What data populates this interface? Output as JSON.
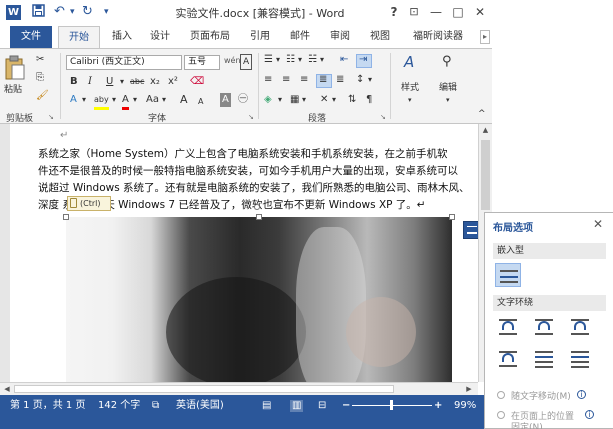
{
  "window": {
    "title": "实验文件.docx [兼容模式] - Word",
    "app_icon": "W",
    "quick_access": [
      "save-icon",
      "undo-icon",
      "redo-icon",
      "customize-icon"
    ],
    "controls": {
      "help": "?",
      "ribbon_opts": "⊡",
      "minimize": "—",
      "restore": "□",
      "close": "✕"
    }
  },
  "tabs": [
    {
      "label": "文件"
    },
    {
      "label": "开始"
    },
    {
      "label": "插入"
    },
    {
      "label": "设计"
    },
    {
      "label": "页面布局"
    },
    {
      "label": "引用"
    },
    {
      "label": "邮件"
    },
    {
      "label": "审阅"
    },
    {
      "label": "视图"
    },
    {
      "label": "福昕阅读器"
    }
  ],
  "ribbon": {
    "paste_label": "粘贴",
    "clipboard_label": "剪贴板",
    "font_name": "Calibri (西文正文)",
    "font_size": "五号",
    "font_label": "字体",
    "paragraph_label": "段落",
    "styles_label": "样式",
    "editing_label": "编辑",
    "bold": "B",
    "italic": "I",
    "underline": "U",
    "strike": "abc",
    "subscript": "x₂",
    "superscript": "x²",
    "text_effects": "A",
    "highlight": "aby",
    "font_color": "A",
    "change_case": "Aa",
    "grow": "A",
    "shrink": "A",
    "char_border": "A"
  },
  "document": {
    "lines": [
      "系统之家（Home System）广义上包含了电脑系统安装和手机系统安装，在之前手机软",
      "件还不是很普及的时候一般特指电脑系统安装，可如今手机用户大量的出现，安卓系统可以",
      "说超过 Windows 系统了。还有就是电脑系统的安装了，我们所熟悉的电脑公司、雨林木风、",
      "深度        系统，今天 Windows 7 已经普及了，微软也宣布不更新 Windows XP 了。↵"
    ],
    "return_mark": "↵",
    "paste_options": "(Ctrl)"
  },
  "status": {
    "page": "第 1 页，共 1 页",
    "words": "142 个字",
    "language": "英语(美国)",
    "zoom_minus": "−",
    "zoom_plus": "+",
    "zoom": "99%",
    "zoom_level": 0.49
  },
  "layout_pane": {
    "title": "布局选项",
    "close": "✕",
    "inline_section": "嵌入型",
    "wrap_section": "文字环绕",
    "move_with_text": "随文字移动(M)",
    "fix_position": "在页面上的位置",
    "fix_position_2": "固定(N)",
    "info": "i"
  },
  "colors": {
    "accent": "#2b579a",
    "selected": "#c5d9f1"
  }
}
